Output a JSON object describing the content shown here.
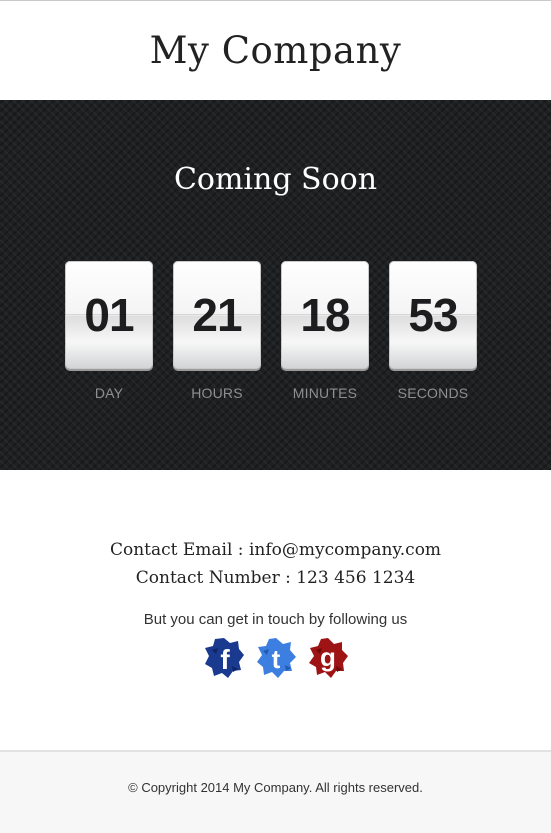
{
  "header": {
    "title": "My Company"
  },
  "hero": {
    "heading": "Coming Soon",
    "countdown": [
      {
        "value": "01",
        "label": "DAY"
      },
      {
        "value": "21",
        "label": "HOURS"
      },
      {
        "value": "18",
        "label": "MINUTES"
      },
      {
        "value": "53",
        "label": "SECONDS"
      }
    ]
  },
  "contact": {
    "email_line": "Contact Email : info@mycompany.com",
    "phone_line": "Contact Number : 123 456 1234"
  },
  "social": {
    "prompt": "But you can get in touch by following us",
    "icons": [
      {
        "name": "facebook-icon",
        "color": "#1a3a8f"
      },
      {
        "name": "twitter-icon",
        "color": "#3d7fe0"
      },
      {
        "name": "google-plus-icon",
        "color": "#9e1414"
      }
    ]
  },
  "footer": {
    "copyright": "© Copyright 2014 My Company. All rights reserved."
  }
}
